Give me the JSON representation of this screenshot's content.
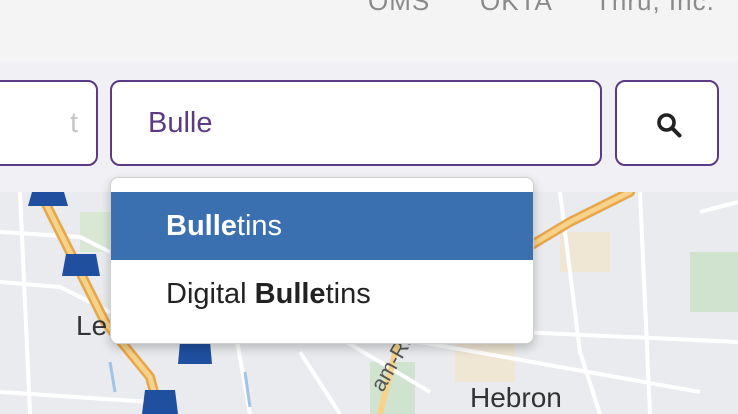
{
  "topnav": {
    "links": [
      "OMS",
      "OKTA",
      "Thru, Inc."
    ]
  },
  "search": {
    "previous_field_fragment": "t",
    "query": "Bulle",
    "button_icon": "search-icon"
  },
  "suggestions": [
    {
      "match": "Bulle",
      "rest": "tins",
      "prefix": "",
      "selected": true
    },
    {
      "match": "Bulle",
      "rest": "tins",
      "prefix": "Digital ",
      "selected": false
    }
  ],
  "map": {
    "labels": [
      "Le",
      "Hebron",
      "am-Ra"
    ]
  },
  "colors": {
    "accent": "#5c3a86",
    "highlight": "#3a6fb0",
    "map_background": "#e9ebee"
  }
}
